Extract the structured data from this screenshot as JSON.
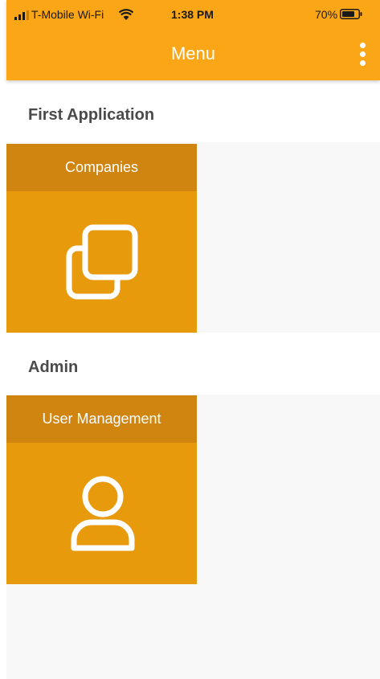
{
  "status_bar": {
    "carrier": "T-Mobile Wi-Fi",
    "time": "1:38 PM",
    "battery_percent": "70%",
    "icons": [
      "signal-icon",
      "wifi-icon",
      "battery-icon"
    ]
  },
  "app_bar": {
    "title": "Menu",
    "menu_icon": "more-vertical-icon"
  },
  "sections": [
    {
      "title": "First Application",
      "tiles": [
        {
          "label": "Companies",
          "icon": "copy-icon"
        }
      ]
    },
    {
      "title": "Admin",
      "tiles": [
        {
          "label": "User Management",
          "icon": "user-icon"
        }
      ]
    }
  ],
  "colors": {
    "app_bar": "#fba617",
    "tile": "#e89a0d",
    "tile_header": "#cf850f",
    "section_title": "#4a4a4a",
    "background": "#f8f8f8"
  }
}
